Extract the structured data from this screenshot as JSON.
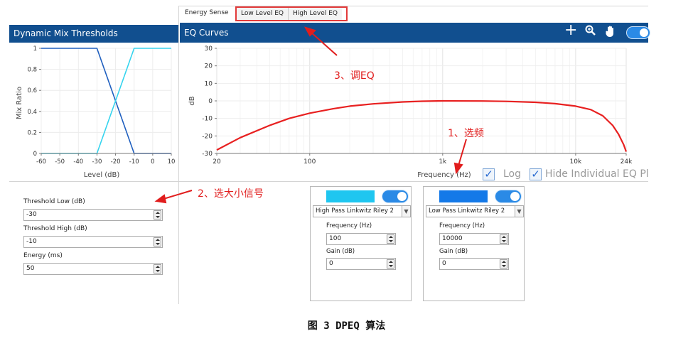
{
  "top_bar": {
    "energy_sense_label": "Energy Sense",
    "tabs": [
      {
        "label": "Low Level EQ"
      },
      {
        "label": "High Level EQ"
      }
    ]
  },
  "mix_panel": {
    "title": "Dynamic Mix Thresholds",
    "chart_data": {
      "type": "line",
      "xlabel": "Level (dB)",
      "ylabel": "Mix Ratio",
      "xlim": [
        -60,
        10
      ],
      "ylim": [
        0,
        1
      ],
      "x_ticks": [
        "-60",
        "-50",
        "-40",
        "-30",
        "-20",
        "-10",
        "0",
        "10"
      ],
      "y_ticks": [
        "0",
        "0.2",
        "0.4",
        "0.6",
        "0.8",
        "1"
      ],
      "grid": true,
      "series": [
        {
          "color": "#1f5fbf",
          "points": [
            [
              -60,
              1
            ],
            [
              -30,
              1
            ],
            [
              -10,
              0
            ],
            [
              10,
              0
            ]
          ]
        },
        {
          "color": "#35d4ee",
          "points": [
            [
              -60,
              0
            ],
            [
              -30,
              0
            ],
            [
              -10,
              1
            ],
            [
              10,
              1
            ]
          ]
        }
      ]
    }
  },
  "eq_panel": {
    "title": "EQ Curves",
    "tools": {
      "add_icon": "plus-icon",
      "zoom_icon": "magnifier-icon",
      "pan_icon": "hand-icon"
    },
    "chart_data": {
      "type": "line",
      "xlabel": "Frequency (Hz)",
      "ylabel": "dB",
      "x_scale": "log",
      "xlim": [
        20,
        24000
      ],
      "ylim": [
        -30,
        30
      ],
      "x_ticks": [
        {
          "value": 20,
          "label": "20"
        },
        {
          "value": 100,
          "label": "100"
        },
        {
          "value": 1000,
          "label": "1k"
        },
        {
          "value": 10000,
          "label": "10k"
        },
        {
          "value": 24000,
          "label": "24k"
        }
      ],
      "y_ticks": [
        "30",
        "20",
        "10",
        "0",
        "-10",
        "-20",
        "-30"
      ],
      "grid": true,
      "series": [
        {
          "color": "#e82020",
          "points": [
            [
              20,
              -28
            ],
            [
              30,
              -21
            ],
            [
              50,
              -14
            ],
            [
              70,
              -10
            ],
            [
              100,
              -7
            ],
            [
              150,
              -4.5
            ],
            [
              200,
              -3
            ],
            [
              300,
              -1.7
            ],
            [
              500,
              -0.6
            ],
            [
              700,
              -0.2
            ],
            [
              1000,
              0
            ],
            [
              2000,
              -0.1
            ],
            [
              3000,
              -0.3
            ],
            [
              5000,
              -0.8
            ],
            [
              7000,
              -1.6
            ],
            [
              10000,
              -3
            ],
            [
              13000,
              -5
            ],
            [
              16000,
              -8.5
            ],
            [
              19000,
              -14
            ],
            [
              21000,
              -19
            ],
            [
              23000,
              -25
            ],
            [
              24000,
              -29
            ]
          ]
        }
      ]
    },
    "log_label": "Log",
    "hide_label": "Hide Individual EQ Plo"
  },
  "thresholds": {
    "low_label": "Threshold Low (dB)",
    "low_value": "-30",
    "high_label": "Threshold High (dB)",
    "high_value": "-10",
    "energy_label": "Energy (ms)",
    "energy_value": "50"
  },
  "filters": [
    {
      "color": "#1fc6f0",
      "type": "High Pass Linkwitz Riley 2",
      "freq_label": "Frequency (Hz)",
      "freq_value": "100",
      "gain_label": "Gain (dB)",
      "gain_value": "0"
    },
    {
      "color": "#1479e8",
      "type": "Low Pass Linkwitz Riley 2",
      "freq_label": "Frequency (Hz)",
      "freq_value": "10000",
      "gain_label": "Gain (dB)",
      "gain_value": "0"
    }
  ],
  "annotations": {
    "a1": "1、选频",
    "a2": "2、选大小信号",
    "a3": "3、调EQ"
  },
  "caption": "图 3  DPEQ 算法"
}
